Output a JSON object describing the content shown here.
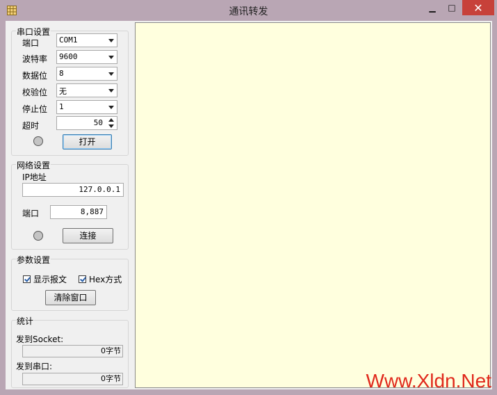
{
  "window": {
    "title": "通讯转发"
  },
  "serial": {
    "group_title": "串口设置",
    "port_label": "端口",
    "port_value": "COM1",
    "baud_label": "波特率",
    "baud_value": "9600",
    "databits_label": "数据位",
    "databits_value": "8",
    "parity_label": "校验位",
    "parity_value": "无",
    "stopbits_label": "停止位",
    "stopbits_value": "1",
    "timeout_label": "超时",
    "timeout_value": "50",
    "open_button": "打开"
  },
  "network": {
    "group_title": "网络设置",
    "ip_label": "IP地址",
    "ip_value": "127.0.0.1",
    "port_label": "端口",
    "port_value": "8,887",
    "connect_button": "连接"
  },
  "params": {
    "group_title": "参数设置",
    "show_packet_label": "显示报文",
    "show_packet_checked": true,
    "hex_label": "Hex方式",
    "hex_checked": true,
    "clear_button": "清除窗口"
  },
  "stats": {
    "group_title": "统计",
    "to_socket_label": "发到Socket:",
    "to_socket_value": "0字节",
    "to_serial_label": "发到串口:",
    "to_serial_value": "0字节"
  },
  "watermark": "Www.Xldn.Net",
  "colors": {
    "log_background": "#ffffde",
    "close_button": "#c7413a",
    "watermark": "#e0281b"
  }
}
